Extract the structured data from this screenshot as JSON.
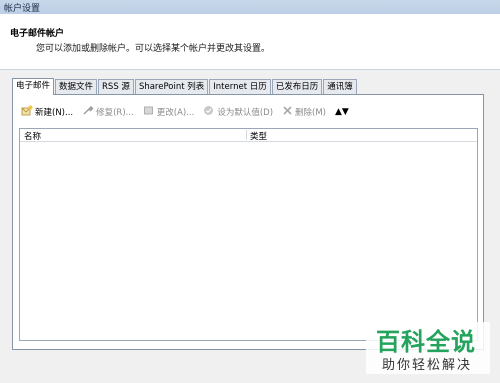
{
  "window": {
    "title": "帐户设置"
  },
  "header": {
    "title": "电子邮件帐户",
    "subtitle": "您可以添加或删除帐户。可以选择某个帐户并更改其设置。"
  },
  "tabs": [
    {
      "label": "电子邮件",
      "active": true
    },
    {
      "label": "数据文件",
      "active": false
    },
    {
      "label": "RSS 源",
      "active": false
    },
    {
      "label": "SharePoint 列表",
      "active": false
    },
    {
      "label": "Internet 日历",
      "active": false
    },
    {
      "label": "已发布日历",
      "active": false
    },
    {
      "label": "通讯簿",
      "active": false
    }
  ],
  "toolbar": {
    "new_label": "新建(N)...",
    "repair_label": "修复(R)...",
    "change_label": "更改(A)...",
    "set_default_label": "设为默认值(D)",
    "remove_label": "删除(M)",
    "move_up_icon": "arrow-up-icon",
    "move_down_icon": "arrow-down-icon"
  },
  "accounts_table": {
    "columns": [
      "名称",
      "类型"
    ],
    "rows": []
  },
  "watermark": {
    "main": "百科全说",
    "sub": "助你轻松解决"
  },
  "colors": {
    "watermark_green": "#23a35b",
    "header_bg": "#ffffff",
    "dialog_bg": "#f0f0f0"
  }
}
